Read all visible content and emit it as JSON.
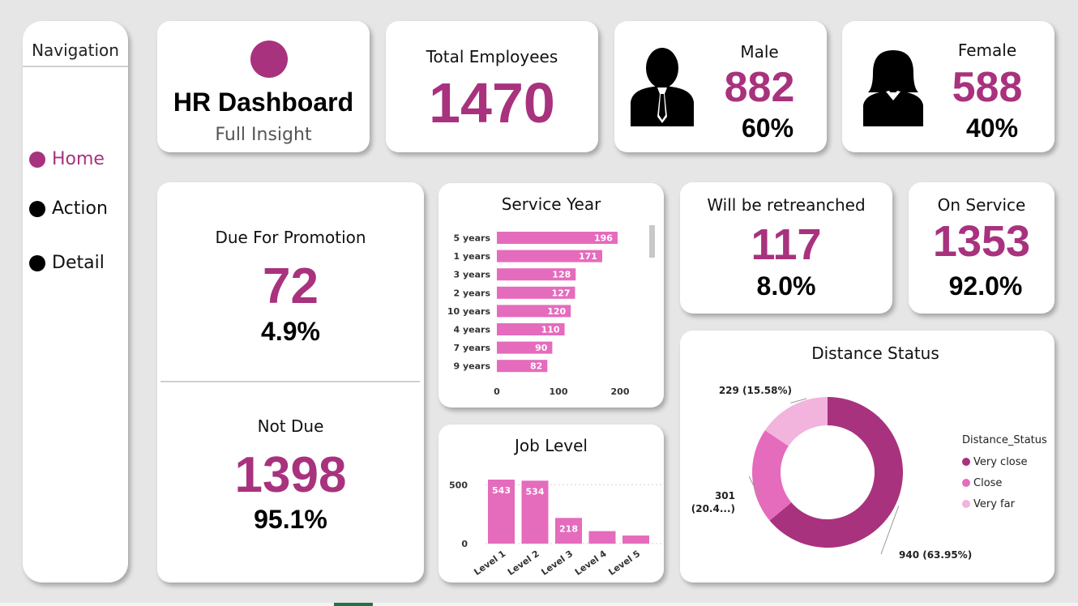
{
  "colors": {
    "accent": "#a8327d",
    "bar": "#e56bbd",
    "very_close": "#a8327d",
    "close": "#e56bbd",
    "very_far": "#f2b3dd",
    "nav_active": "#a8327d"
  },
  "nav": {
    "title": "Navigation",
    "items": [
      {
        "label": "Home",
        "icon": "circle-icon",
        "active": true
      },
      {
        "label": "Action",
        "icon": "circle-icon",
        "active": false
      },
      {
        "label": "Detail",
        "icon": "circle-icon",
        "active": false
      }
    ]
  },
  "header": {
    "logo_icon": "circle-icon",
    "title": "HR Dashboard",
    "subtitle": "Full Insight"
  },
  "kpis": {
    "total": {
      "label": "Total Employees",
      "value": "1470"
    },
    "male": {
      "label": "Male",
      "value": "882",
      "pct": "60%",
      "icon": "male-person-icon"
    },
    "female": {
      "label": "Female",
      "value": "588",
      "pct": "40%",
      "icon": "female-person-icon"
    },
    "promotion": {
      "label": "Due For Promotion",
      "value": "72",
      "pct": "4.9%"
    },
    "not_due": {
      "label": "Not Due",
      "value": "1398",
      "pct": "95.1%"
    },
    "retrenched": {
      "label": "Will be retreanched",
      "value": "117",
      "pct": "8.0%"
    },
    "on_service": {
      "label": "On Service",
      "value": "1353",
      "pct": "92.0%"
    }
  },
  "chart_data": [
    {
      "type": "bar",
      "orientation": "horizontal",
      "title": "Service Year",
      "categories": [
        "5 years",
        "1 years",
        "3 years",
        "2 years",
        "10 years",
        "4 years",
        "7 years",
        "9 years"
      ],
      "values": [
        196,
        171,
        128,
        127,
        120,
        110,
        90,
        82
      ],
      "xlim": [
        0,
        200
      ],
      "xticks": [
        0,
        100,
        200
      ],
      "scrollbar": true
    },
    {
      "type": "bar",
      "title": "Job Level",
      "categories": [
        "Level 1",
        "Level 2",
        "Level 3",
        "Level 4",
        "Level 5"
      ],
      "values": [
        543,
        534,
        218,
        106,
        69
      ],
      "data_labels": [
        "543",
        "534",
        "218",
        "",
        ""
      ],
      "ylim": [
        0,
        550
      ],
      "yticks": [
        0,
        500
      ],
      "grid": true
    },
    {
      "type": "pie",
      "donut": true,
      "title": "Distance Status",
      "legend_title": "Distance_Status",
      "legend_position": "right",
      "categories": [
        "Very close",
        "Close",
        "Very far"
      ],
      "values": [
        940,
        301,
        229
      ],
      "data_labels": [
        "940 (63.95%)",
        "301 (20.4...)",
        "229 (15.58%)"
      ]
    }
  ]
}
